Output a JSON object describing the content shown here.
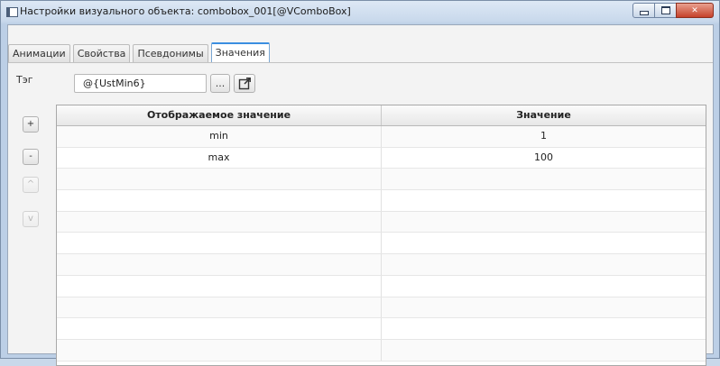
{
  "window": {
    "title": "Настройки визуального объекта: combobox_001[@VComboBox]"
  },
  "tabs": [
    {
      "label": "Анимации",
      "active": false
    },
    {
      "label": "Свойства",
      "active": false
    },
    {
      "label": "Псевдонимы",
      "active": false
    },
    {
      "label": "Значения",
      "active": true
    }
  ],
  "tag": {
    "label": "Тэг",
    "value": "@{UstMin6}",
    "browse_label": "..."
  },
  "side_buttons": {
    "add": "+",
    "remove": "-",
    "up": "^",
    "down": "v"
  },
  "table": {
    "headers": [
      "Отображаемое значение",
      "Значение"
    ],
    "rows": [
      [
        "min",
        "1"
      ],
      [
        "max",
        "100"
      ],
      [
        "",
        ""
      ],
      [
        "",
        ""
      ],
      [
        "",
        ""
      ],
      [
        "",
        ""
      ],
      [
        "",
        ""
      ],
      [
        "",
        ""
      ],
      [
        "",
        ""
      ],
      [
        "",
        ""
      ],
      [
        "",
        ""
      ]
    ]
  },
  "icons": {
    "app": "window-icon",
    "open": "open-external-icon"
  }
}
